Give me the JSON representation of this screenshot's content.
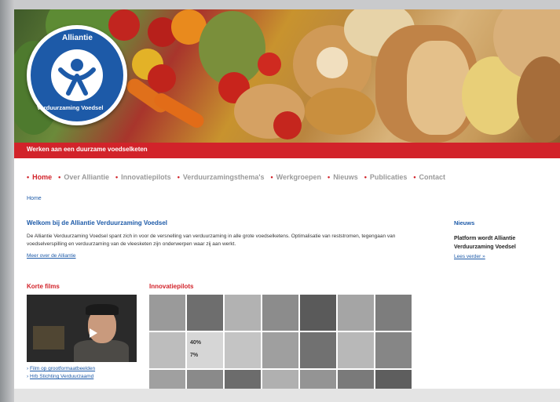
{
  "banner": {
    "logo_lines": [
      "Alliantie",
      "Verduurzaming Voedsel"
    ],
    "tagline": "Werken aan een duurzame voedselketen"
  },
  "nav": {
    "items": [
      {
        "label": "Home",
        "active": true
      },
      {
        "label": "Over Alliantie",
        "active": false
      },
      {
        "label": "Innovatiepilots",
        "active": false
      },
      {
        "label": "Verduurzamingsthema's",
        "active": false
      },
      {
        "label": "Werkgroepen",
        "active": false
      },
      {
        "label": "Nieuws",
        "active": false
      },
      {
        "label": "Publicaties",
        "active": false
      },
      {
        "label": "Contact",
        "active": false
      }
    ]
  },
  "breadcrumb": "Home",
  "welcome": {
    "title": "Welkom bij de Alliantie Verduurzaming Voedsel",
    "body": "De Alliantie Verduurzaming Voedsel spant zich in voor de versnelling van verduurzaming in alle grote voedselketens. Optimalisatie van reststromen, tegengaan van voedselverspilling en verduurzaming van de vleesketen zijn onderwerpen waar zij aan werkt.",
    "read_more": "Meer over de Alliantie"
  },
  "news": {
    "title": "Nieuws",
    "headline": "Platform wordt Alliantie Verduurzaming Voedsel",
    "read_more": "Lees verder »"
  },
  "films": {
    "title": "Korte films",
    "links": [
      "Film op grootformaatbeelden",
      "Hrb Stichting Verduurzaamd"
    ]
  },
  "innovatiepilots": {
    "title": "Innovatiepilots",
    "tile_labels": [
      "40%",
      "7%"
    ]
  },
  "colors": {
    "brand_red": "#d2232a",
    "brand_blue": "#1d5aa8"
  }
}
